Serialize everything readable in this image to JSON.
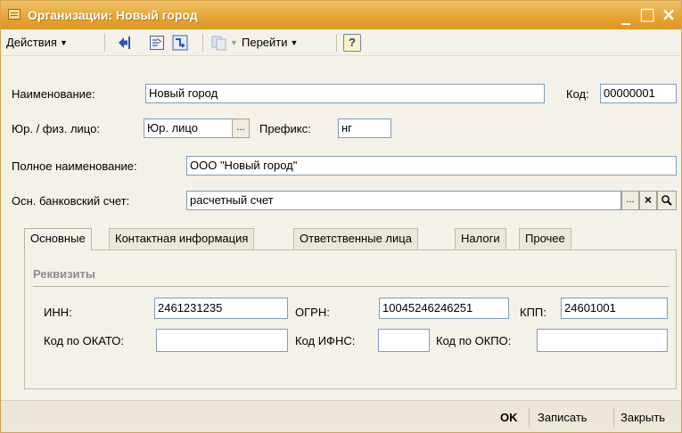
{
  "window": {
    "title": "Организации: Новый город",
    "minimize_glyph": "_",
    "maximize_glyph": "□",
    "close_glyph": "×"
  },
  "toolbar": {
    "actions_label": "Действия",
    "goto_label": "Перейти",
    "help_label": "?"
  },
  "form": {
    "name_label": "Наименование:",
    "name_value": "Новый город",
    "code_label": "Код:",
    "code_value": "00000001",
    "legal_type_label": "Юр. / физ. лицо:",
    "legal_type_value": "Юр. лицо",
    "select_button": "...",
    "prefix_label": "Префикс:",
    "prefix_value": "нг",
    "full_name_label": "Полное наименование:",
    "full_name_value": "ООО \"Новый город\"",
    "bank_account_label": "Осн. банковский счет:",
    "bank_account_value": "расчетный счет",
    "clear_button": "×"
  },
  "tabs": [
    {
      "label": "Основные",
      "active": true
    },
    {
      "label": "Контактная информация",
      "active": false
    },
    {
      "label": "Ответственные лица",
      "active": false
    },
    {
      "label": "Налоги",
      "active": false
    },
    {
      "label": "Прочее",
      "active": false
    }
  ],
  "requisites": {
    "section_title": "Реквизиты",
    "inn_label": "ИНН:",
    "inn_value": "2461231235",
    "ogrn_label": "ОГРН:",
    "ogrn_value": "10045246246251",
    "kpp_label": "КПП:",
    "kpp_value": "24601001",
    "okato_label": "Код по ОКАТО:",
    "okato_value": "",
    "ifns_label": "Код ИФНС:",
    "ifns_value": "",
    "okpo_label": "Код по ОКПО:",
    "okpo_value": ""
  },
  "footer": {
    "ok_label": "OK",
    "save_label": "Записать",
    "close_label": "Закрыть"
  },
  "colors": {
    "titlebar": "#e7a637",
    "window_bg": "#f4f1e8",
    "field_border": "#7f9db9"
  }
}
